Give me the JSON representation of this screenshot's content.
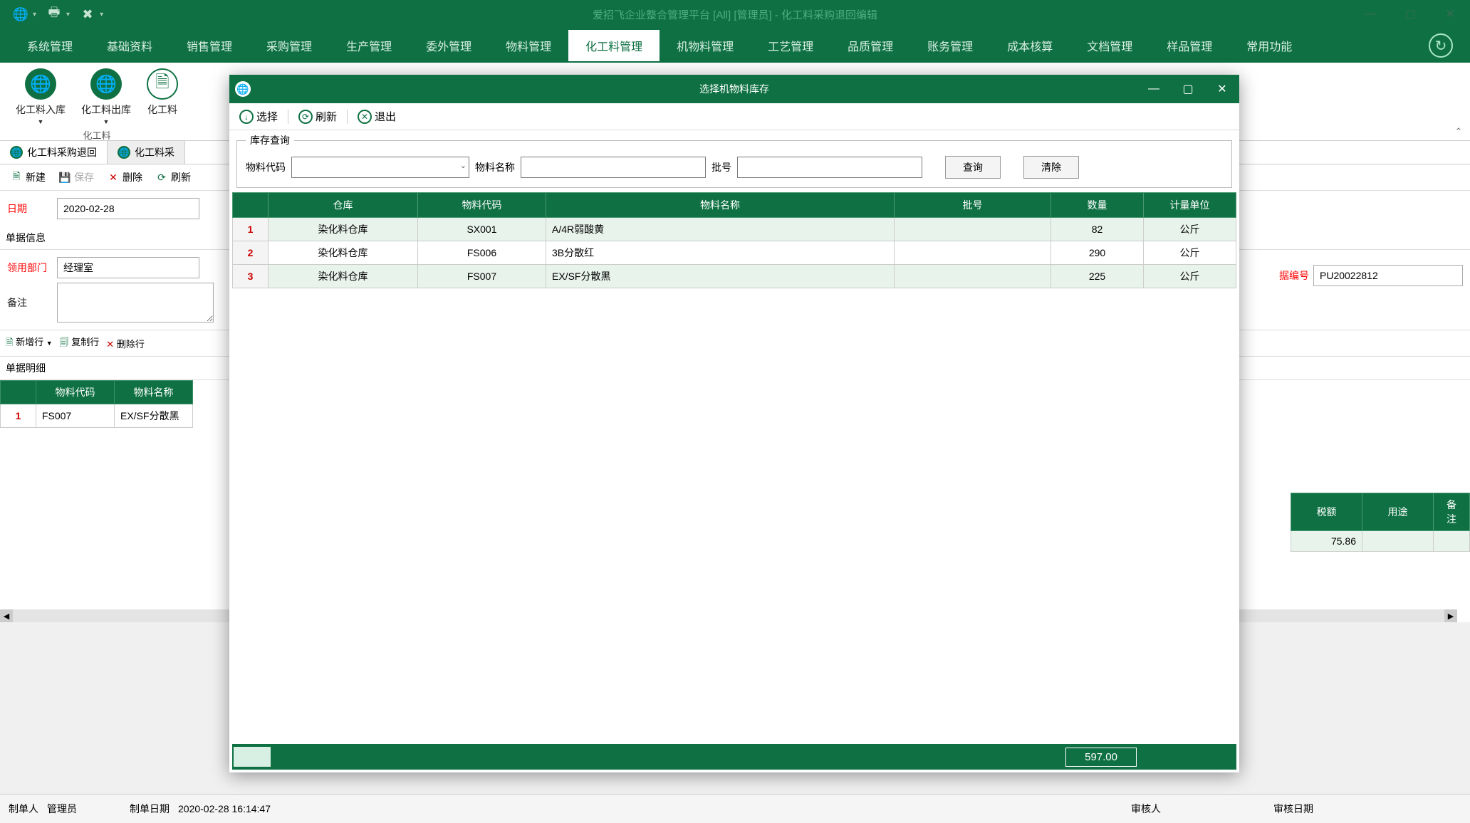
{
  "titlebar": {
    "title": "爱招飞企业整合管理平台 [All] [管理员] - 化工料采购退回编辑"
  },
  "menus": [
    "系统管理",
    "基础资料",
    "销售管理",
    "采购管理",
    "生产管理",
    "委外管理",
    "物料管理",
    "化工料管理",
    "机物料管理",
    "工艺管理",
    "品质管理",
    "账务管理",
    "成本核算",
    "文档管理",
    "样品管理",
    "常用功能"
  ],
  "menu_active_index": 7,
  "ribbon": {
    "buttons": [
      {
        "label": "化工料入库",
        "dropdown": true
      },
      {
        "label": "化工料出库",
        "dropdown": true
      },
      {
        "label": "化工料",
        "partial": true
      }
    ],
    "group_label": "化工料"
  },
  "tabs": [
    {
      "label": "化工料采购退回",
      "active": true
    },
    {
      "label": "化工料采",
      "partial": true
    }
  ],
  "toolbar": {
    "new": "新建",
    "save": "保存",
    "delete": "删除",
    "refresh": "刷新"
  },
  "form": {
    "date_label": "日期",
    "date_value": "2020-02-28",
    "section_label": "单据信息",
    "dept_label": "领用部门",
    "dept_value": "经理室",
    "remark_label": "备注",
    "remark_value": "",
    "doc_no_label": "据编号",
    "doc_no_value": "PU20022812"
  },
  "toolbar2": {
    "addrow": "新增行",
    "copyrow": "复制行",
    "deleterow": "删除行"
  },
  "detail": {
    "section_label": "单据明细",
    "headers_left": [
      "",
      "物料代码",
      "物料名称"
    ],
    "headers_right": [
      "税额",
      "用途",
      "备注"
    ],
    "row": {
      "num": "1",
      "code": "FS007",
      "name": "EX/SF分散黑",
      "tax": "75.86"
    }
  },
  "footer": {
    "creator_label": "制单人",
    "creator_value": "管理员",
    "create_date_label": "制单日期",
    "create_date_value": "2020-02-28 16:14:47",
    "auditor_label": "审核人",
    "auditor_value": "",
    "audit_date_label": "审核日期",
    "audit_date_value": ""
  },
  "dialog": {
    "title": "选择机物料库存",
    "tb": {
      "select": "选择",
      "refresh": "刷新",
      "exit": "退出"
    },
    "fieldset_legend": "库存查询",
    "search": {
      "code_label": "物料代码",
      "code_value": "",
      "name_label": "物料名称",
      "name_value": "",
      "batch_label": "批号",
      "batch_value": "",
      "query_btn": "查询",
      "clear_btn": "清除"
    },
    "grid": {
      "headers": [
        "仓库",
        "物料代码",
        "物料名称",
        "批号",
        "数量",
        "计量单位"
      ],
      "rows": [
        {
          "num": "1",
          "wh": "染化料仓库",
          "code": "SX001",
          "name": "A/4R弱酸黄",
          "batch": "",
          "qty": "82",
          "uom": "公斤"
        },
        {
          "num": "2",
          "wh": "染化料仓库",
          "code": "FS006",
          "name": "3B分散红",
          "batch": "",
          "qty": "290",
          "uom": "公斤"
        },
        {
          "num": "3",
          "wh": "染化料仓库",
          "code": "FS007",
          "name": "EX/SF分散黑",
          "batch": "",
          "qty": "225",
          "uom": "公斤"
        }
      ],
      "sum": "597.00"
    }
  }
}
